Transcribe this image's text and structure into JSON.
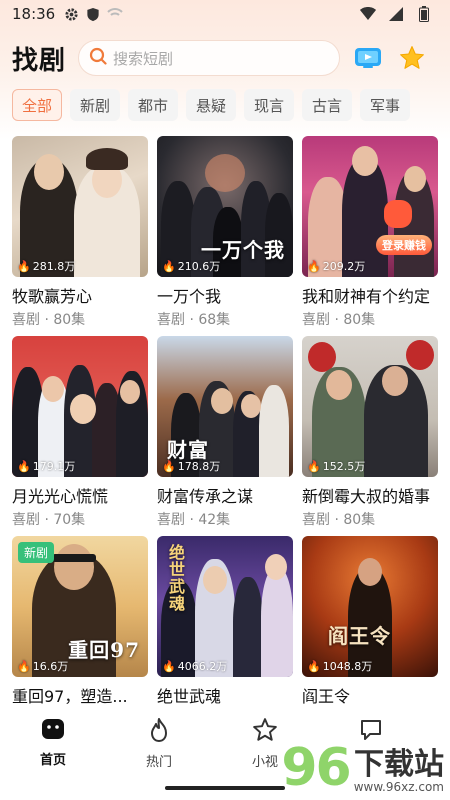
{
  "status_bar": {
    "time": "18:36"
  },
  "header": {
    "title": "找剧",
    "search_placeholder": "搜索短剧"
  },
  "tabs": [
    {
      "label": "全部",
      "active": true
    },
    {
      "label": "新剧",
      "active": false
    },
    {
      "label": "都市",
      "active": false
    },
    {
      "label": "悬疑",
      "active": false
    },
    {
      "label": "现言",
      "active": false
    },
    {
      "label": "古言",
      "active": false
    },
    {
      "label": "军事",
      "active": false
    }
  ],
  "dramas": [
    {
      "title": "牧歌赢芳心",
      "meta": "喜剧 · 80集",
      "views": "281.8万"
    },
    {
      "title": "一万个我",
      "meta": "喜剧 · 68集",
      "views": "210.6万",
      "poster_text": "一万个我"
    },
    {
      "title": "我和财神有个约定",
      "meta": "喜剧 · 80集",
      "views": "209.2万",
      "promo": "登录赚钱"
    },
    {
      "title": "月光光心慌慌",
      "meta": "喜剧 · 70集",
      "views": "179.1万"
    },
    {
      "title": "财富传承之谋",
      "meta": "喜剧 · 42集",
      "views": "178.8万",
      "poster_text": "财富"
    },
    {
      "title": "新倒霉大叔的婚事",
      "meta": "喜剧 · 80集",
      "views": "152.5万"
    },
    {
      "title": "重回97，塑造...",
      "meta": "",
      "views": "16.6万",
      "badge": "新剧",
      "poster_text": "重回97"
    },
    {
      "title": "绝世武魂",
      "meta": "",
      "views": "4066.2万",
      "poster_text": "绝世武魂"
    },
    {
      "title": "阎王令",
      "meta": "",
      "views": "1048.8万",
      "poster_text": "阎王令"
    }
  ],
  "bottom_nav": [
    {
      "label": "首页",
      "icon": "home-icon",
      "active": true
    },
    {
      "label": "热门",
      "icon": "flame-icon",
      "active": false
    },
    {
      "label": "小视",
      "icon": "star-icon",
      "active": false
    },
    {
      "label": "",
      "icon": "chat-icon",
      "active": false
    }
  ],
  "watermark": {
    "number": "96",
    "text": "下载站",
    "url": "www.96xz.com"
  },
  "colors": {
    "accent": "#f07040",
    "tab_active_bg": "#fff1ea",
    "new_badge": "#36c07a"
  }
}
